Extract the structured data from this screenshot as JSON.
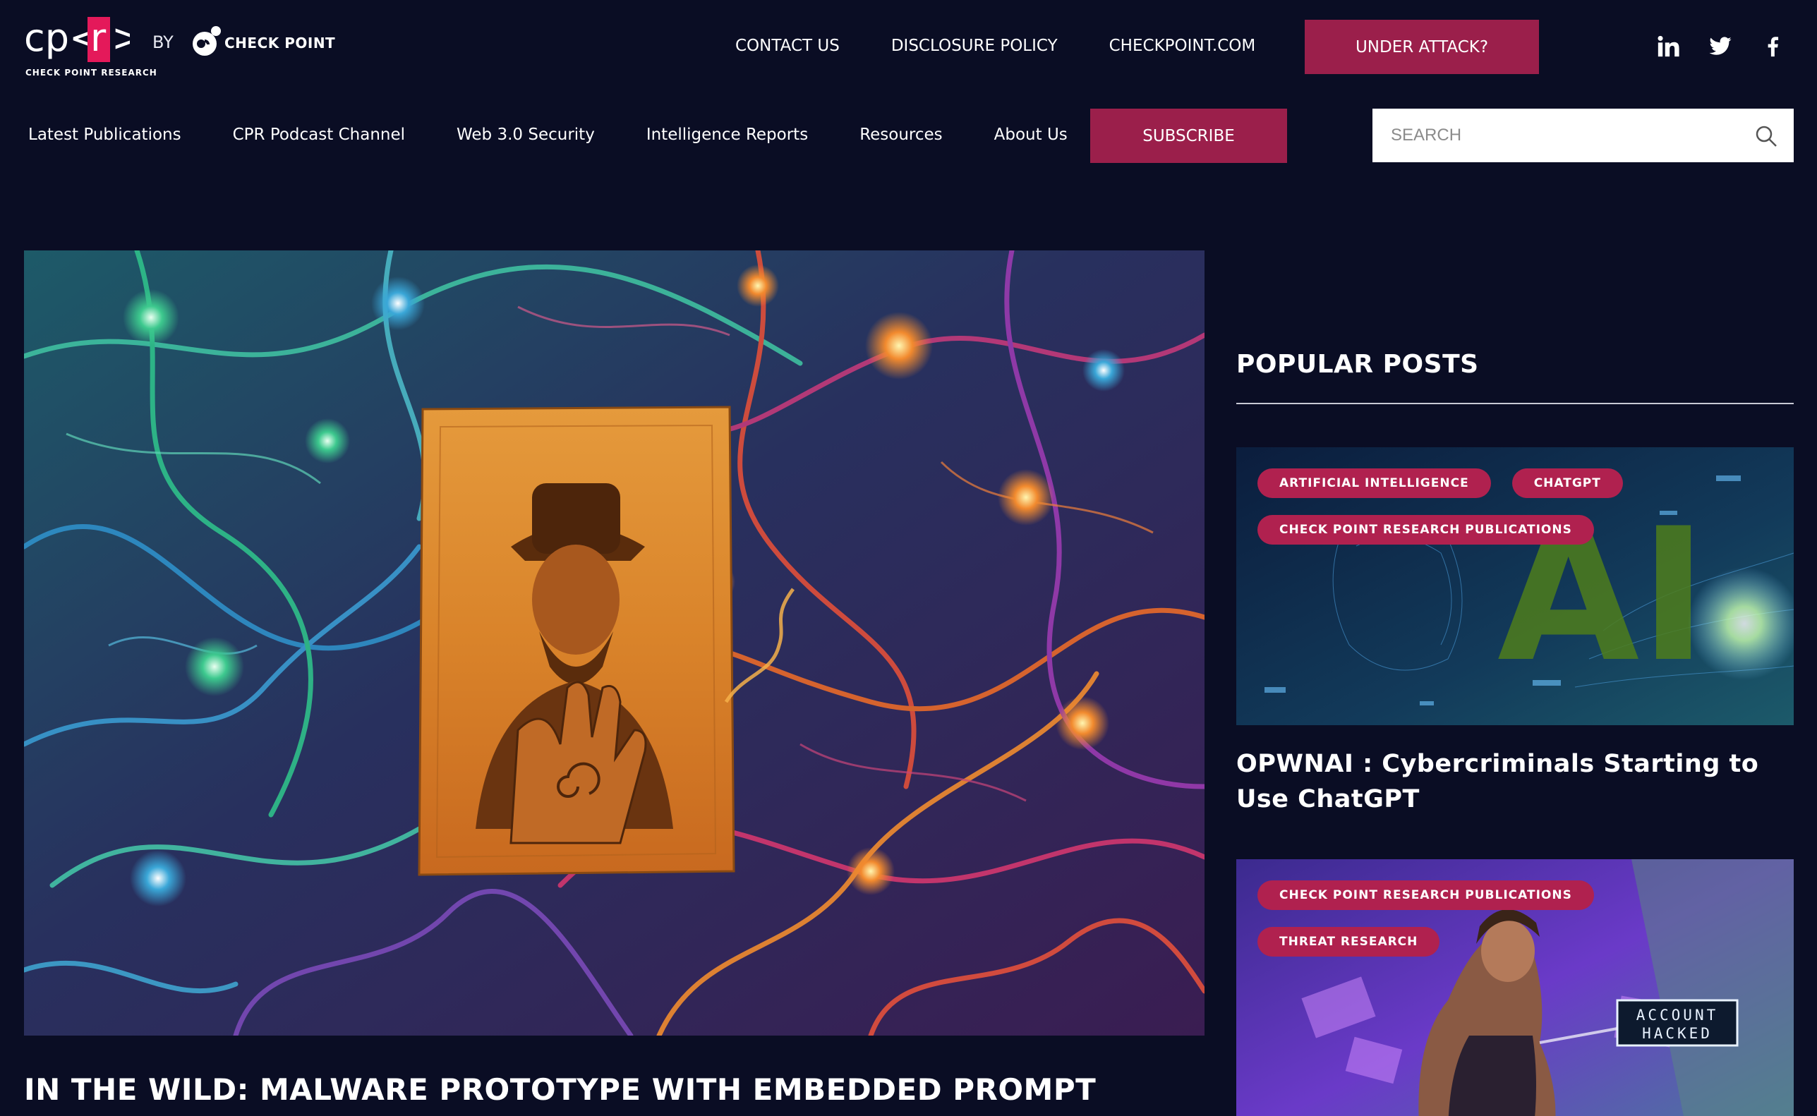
{
  "brand": {
    "logo_text": "cp<r>",
    "logo_subtitle": "CHECK POINT RESEARCH",
    "by_label": "BY",
    "partner_logo_text": "CHECK POINT"
  },
  "top_nav": {
    "links": [
      "CONTACT US",
      "DISCLOSURE POLICY",
      "CHECKPOINT.COM"
    ],
    "cta_label": "UNDER ATTACK?",
    "social_icons": [
      "linkedin-icon",
      "twitter-icon",
      "facebook-icon"
    ]
  },
  "main_nav": {
    "items": [
      "Latest Publications",
      "CPR Podcast Channel",
      "Web 3.0 Security",
      "Intelligence Reports",
      "Resources",
      "About Us"
    ],
    "subscribe_label": "SUBSCRIBE",
    "search_placeholder": "SEARCH"
  },
  "hero": {
    "title": "IN THE WILD: MALWARE PROTOTYPE WITH EMBEDDED PROMPT"
  },
  "sidebar": {
    "heading": "POPULAR POSTS",
    "posts": [
      {
        "tags": [
          "ARTIFICIAL INTELLIGENCE",
          "CHATGPT",
          "CHECK POINT RESEARCH PUBLICATIONS"
        ],
        "title": "OPWNAI : Cybercriminals Starting to Use ChatGPT",
        "thumb_text": "AI"
      },
      {
        "tags": [
          "CHECK POINT RESEARCH PUBLICATIONS",
          "THREAT RESEARCH"
        ],
        "title": "",
        "thumb_text": "ACCOUNT HACKED"
      }
    ]
  },
  "colors": {
    "background": "#0a0d24",
    "accent": "#9b1f4b",
    "tag": "#b0214f"
  }
}
